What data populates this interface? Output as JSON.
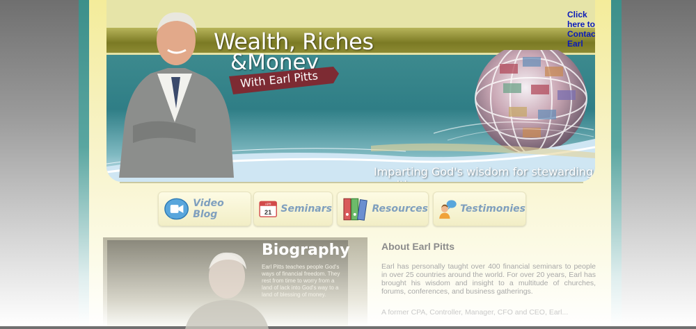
{
  "header": {
    "contact_link": "Click here to Contact Earl",
    "title_line1": "Wealth, Riches",
    "title_line2": "&Money",
    "ribbon": "With Earl Pitts",
    "tagline": "Imparting God's wisdom for stewarding wealth"
  },
  "nav": [
    {
      "label": "Video Blog",
      "icon": "video-icon"
    },
    {
      "label": "Seminars",
      "icon": "calendar-icon",
      "calendar_month": "APR",
      "calendar_day": "21"
    },
    {
      "label": "Resources",
      "icon": "binders-icon"
    },
    {
      "label": "Testimonies",
      "icon": "person-speech-icon"
    }
  ],
  "biography": {
    "title": "Biography",
    "text": "Earl Pitts teaches people God's ways of financial freedom. They rest from time to worry from a land of lack into God's way to a land of blessing of money."
  },
  "about": {
    "heading": "About Earl Pitts",
    "paragraph1": "Earl has personally taught over 400 financial seminars to people in over 25 countries around the world. For over 20 years, Earl has brought his wisdom and insight to a multitude of churches, forums, conferences, and business gatherings.",
    "paragraph2": "A former CPA, Controller, Manager, CFO and CEO, Earl..."
  },
  "colors": {
    "link": "#0a1ab8",
    "nav_label": "#7f9fbe",
    "ribbon": "#7d2b33"
  }
}
